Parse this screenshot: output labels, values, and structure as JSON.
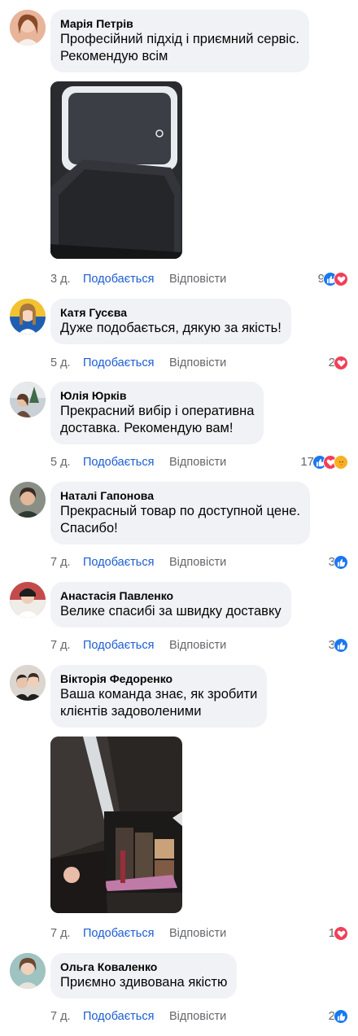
{
  "colors": {
    "link": "#1b5cd3",
    "meta": "#65676b",
    "bubble": "#f0f2f5",
    "like": "#1877f2",
    "love": "#f33e58",
    "care": "#f7b125"
  },
  "labels": {
    "like": "Подобається",
    "reply": "Відповісти"
  },
  "comments": [
    {
      "author": "Марія Петрів",
      "text": "Професійний підхід і приємний сервіс.\nРекомендую всім",
      "time": "3 д.",
      "count": "9",
      "reactions": [
        "like-icon",
        "love-icon"
      ],
      "photo": "mirror-case-photo"
    },
    {
      "author": "Катя Гусєва",
      "text": "Дуже подобається, дякую за якість!",
      "time": "5 д.",
      "count": "2",
      "reactions": [
        "love-icon"
      ]
    },
    {
      "author": "Юлія Юрків",
      "text": "Прекрасний вибір і оперативна\nдоставка. Рекомендую вам!",
      "time": "5 д.",
      "count": "17",
      "reactions": [
        "like-icon",
        "love-icon",
        "care-icon"
      ]
    },
    {
      "author": "Наталі Гапонова",
      "text": "Прекрасный товар по доступной цене.\nСпасибо!",
      "time": "7 д.",
      "count": "3",
      "reactions": [
        "like-icon"
      ]
    },
    {
      "author": "Анастасія Павленко",
      "text": "Велике спасибі за швидку доставку",
      "time": "7 д.",
      "count": "3",
      "reactions": [
        "like-icon"
      ]
    },
    {
      "author": "Вікторія Федоренко",
      "text": "Ваша команда знає, як зробити\nклієнтів задоволеними",
      "time": "7 д.",
      "count": "1",
      "reactions": [
        "love-icon"
      ],
      "photo": "cosmetics-case-photo"
    },
    {
      "author": "Ольга Коваленко",
      "text": "Приємно здивована якістю",
      "time": "7 д.",
      "count": "2",
      "reactions": [
        "like-icon"
      ]
    }
  ]
}
